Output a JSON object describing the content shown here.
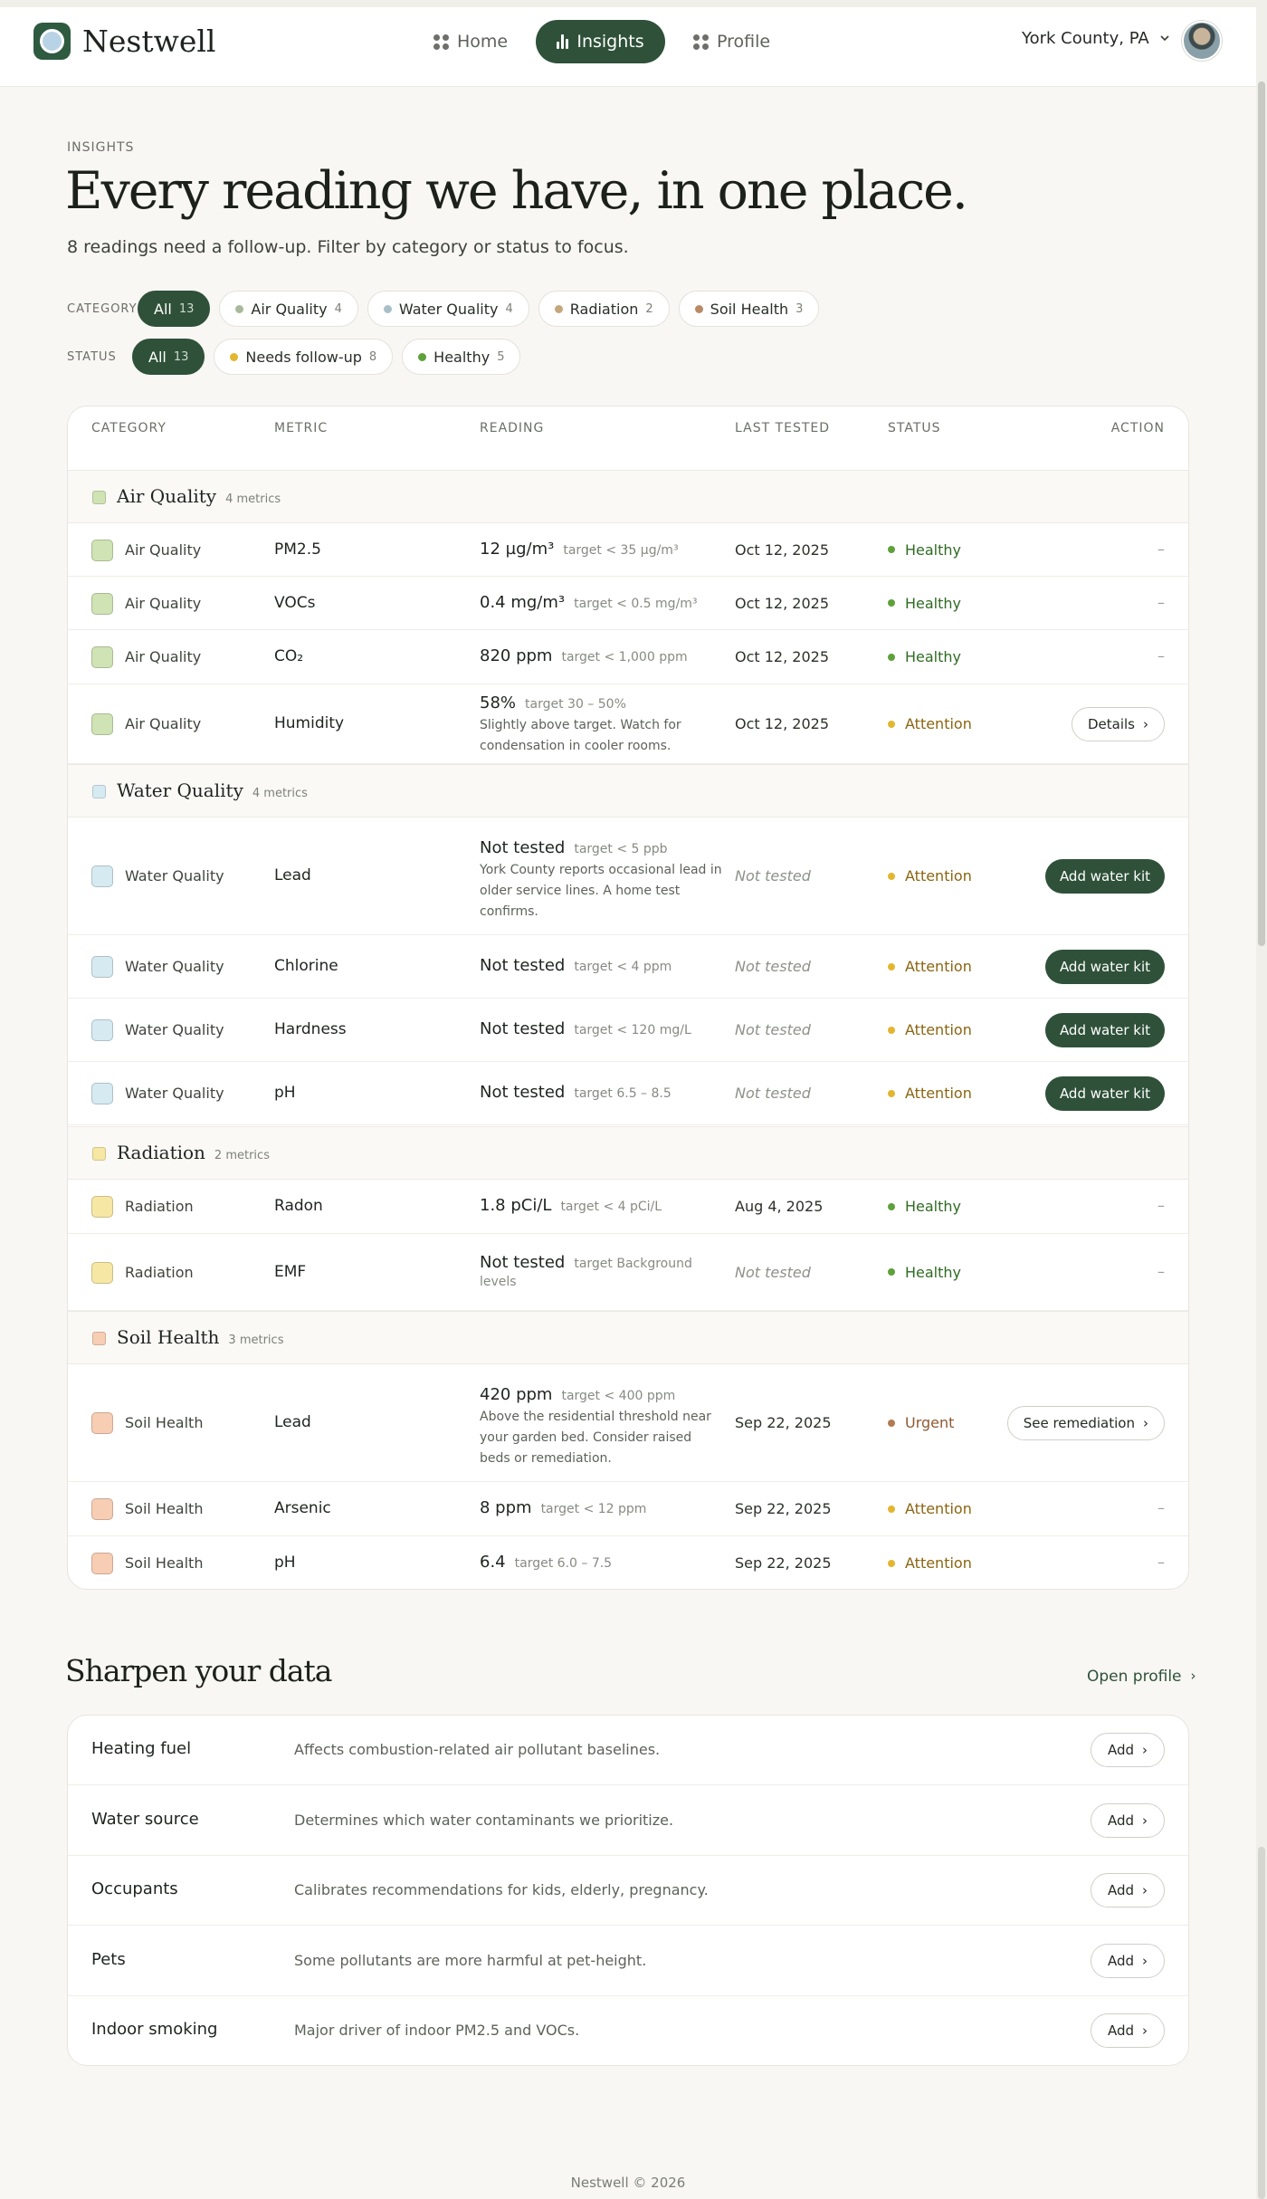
{
  "brand": {
    "name": "Nestwell"
  },
  "nav": {
    "home": "Home",
    "insights": "Insights",
    "profile": "Profile"
  },
  "location": "York County, PA",
  "page": {
    "eyebrow": "INSIGHTS",
    "title": "Every reading we have, in one place.",
    "subtitle": "8 readings need a follow-up. Filter by category or status to focus."
  },
  "filters": {
    "category_label": "CATEGORY",
    "status_label": "STATUS",
    "category_chips": [
      {
        "label": "All",
        "count": "13",
        "active": true
      },
      {
        "label": "Air Quality",
        "count": "4",
        "color": "#a8b99a"
      },
      {
        "label": "Water Quality",
        "count": "4",
        "color": "#a8bfc9"
      },
      {
        "label": "Radiation",
        "count": "2",
        "color": "#c4a77c"
      },
      {
        "label": "Soil Health",
        "count": "3",
        "color": "#b98a66"
      }
    ],
    "status_chips": [
      {
        "label": "All",
        "count": "13",
        "active": true
      },
      {
        "label": "Needs follow-up",
        "count": "8",
        "color": "#e3b62f"
      },
      {
        "label": "Healthy",
        "count": "5",
        "color": "#5ea13a"
      }
    ]
  },
  "table": {
    "headers": {
      "category": "CATEGORY",
      "metric": "METRIC",
      "reading": "READING",
      "last_tested": "LAST TESTED",
      "status": "STATUS",
      "action": "ACTION"
    },
    "groups": {
      "air": {
        "name": "Air Quality",
        "count": "4 metrics"
      },
      "water": {
        "name": "Water Quality",
        "count": "4 metrics"
      },
      "radiation": {
        "name": "Radiation",
        "count": "2 metrics"
      },
      "soil": {
        "name": "Soil Health",
        "count": "3 metrics"
      }
    },
    "rows": [
      {
        "category": "Air Quality",
        "metric": "PM2.5",
        "value": "12 µg/m³",
        "target": "target < 35 µg/m³",
        "note": "",
        "date": "Oct 12, 2025",
        "status": "Healthy",
        "action": "–"
      },
      {
        "category": "Air Quality",
        "metric": "VOCs",
        "value": "0.4 mg/m³",
        "target": "target < 0.5 mg/m³",
        "note": "",
        "date": "Oct 12, 2025",
        "status": "Healthy",
        "action": "–"
      },
      {
        "category": "Air Quality",
        "metric": "CO₂",
        "value": "820 ppm",
        "target": "target < 1,000 ppm",
        "note": "",
        "date": "Oct 12, 2025",
        "status": "Healthy",
        "action": "–"
      },
      {
        "category": "Air Quality",
        "metric": "Humidity",
        "value": "58%",
        "target": "target 30 – 50%",
        "note": "Slightly above target. Watch for condensation in cooler rooms.",
        "date": "Oct 12, 2025",
        "status": "Attention",
        "action": "Details"
      },
      {
        "category": "Water Quality",
        "metric": "Lead",
        "value": "Not tested",
        "target": "target < 5 ppb",
        "note": "York County reports occasional lead in older service lines. A home test confirms.",
        "date": "Not tested",
        "status": "Attention",
        "action": "Add water kit"
      },
      {
        "category": "Water Quality",
        "metric": "Chlorine",
        "value": "Not tested",
        "target": "target < 4 ppm",
        "note": "",
        "date": "Not tested",
        "status": "Attention",
        "action": "Add water kit"
      },
      {
        "category": "Water Quality",
        "metric": "Hardness",
        "value": "Not tested",
        "target": "target < 120 mg/L",
        "note": "",
        "date": "Not tested",
        "status": "Attention",
        "action": "Add water kit"
      },
      {
        "category": "Water Quality",
        "metric": "pH",
        "value": "Not tested",
        "target": "target 6.5 – 8.5",
        "note": "",
        "date": "Not tested",
        "status": "Attention",
        "action": "Add water kit"
      },
      {
        "category": "Radiation",
        "metric": "Radon",
        "value": "1.8 pCi/L",
        "target": "target < 4 pCi/L",
        "note": "",
        "date": "Aug 4, 2025",
        "status": "Healthy",
        "action": "–"
      },
      {
        "category": "Radiation",
        "metric": "EMF",
        "value": "Not tested",
        "target": "target Background levels",
        "note": "",
        "date": "Not tested",
        "status": "Healthy",
        "action": "–"
      },
      {
        "category": "Soil Health",
        "metric": "Lead",
        "value": "420 ppm",
        "target": "target < 400 ppm",
        "note": "Above the residential threshold near your garden bed. Consider raised beds or remediation.",
        "date": "Sep 22, 2025",
        "status": "Urgent",
        "action": "See remediation"
      },
      {
        "category": "Soil Health",
        "metric": "Arsenic",
        "value": "8 ppm",
        "target": "target < 12 ppm",
        "note": "",
        "date": "Sep 22, 2025",
        "status": "Attention",
        "action": "–"
      },
      {
        "category": "Soil Health",
        "metric": "pH",
        "value": "6.4",
        "target": "target 6.0 – 7.5",
        "note": "",
        "date": "Sep 22, 2025",
        "status": "Attention",
        "action": "–"
      }
    ]
  },
  "sharpen": {
    "title": "Sharpen your data",
    "open_profile": "Open profile",
    "items": [
      {
        "label": "Heating fuel",
        "desc": "Affects combustion-related air pollutant baselines.",
        "button": "Add"
      },
      {
        "label": "Water source",
        "desc": "Determines which water contaminants we prioritize.",
        "button": "Add"
      },
      {
        "label": "Occupants",
        "desc": "Calibrates recommendations for kids, elderly, pregnancy.",
        "button": "Add"
      },
      {
        "label": "Pets",
        "desc": "Some pollutants are more harmful at pet-height.",
        "button": "Add"
      },
      {
        "label": "Indoor smoking",
        "desc": "Major driver of indoor PM2.5 and VOCs.",
        "button": "Add"
      }
    ]
  },
  "footer": "Nestwell © 2026",
  "colors": {
    "brand_green": "#2f5139",
    "air_swatch": "#cfe3b4",
    "water_swatch": "#d6eaf2",
    "radiation_swatch": "#f7e7a4",
    "soil_swatch": "#f7cdb4",
    "healthy": "#5ea13a",
    "attention": "#e3b62f",
    "urgent": "#b37b50"
  }
}
